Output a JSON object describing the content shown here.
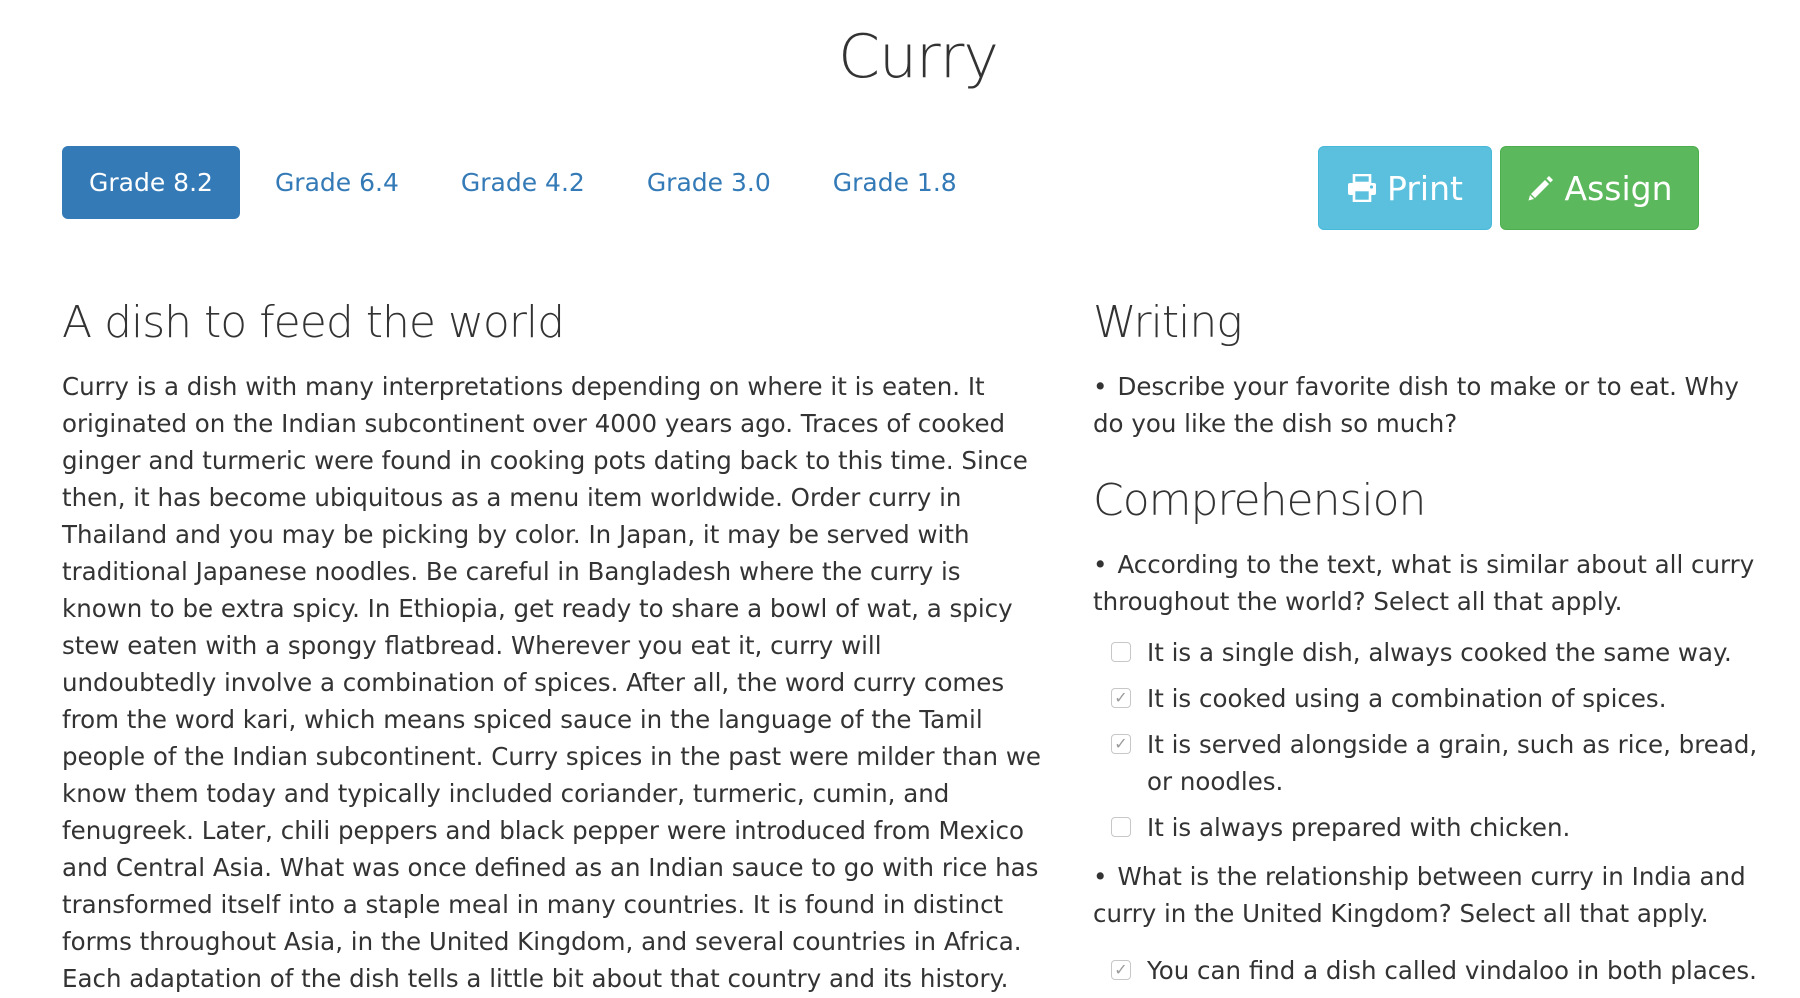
{
  "page_title": "Curry",
  "grade_tabs": [
    {
      "label": "Grade 8.2",
      "active": true
    },
    {
      "label": "Grade 6.4",
      "active": false
    },
    {
      "label": "Grade 4.2",
      "active": false
    },
    {
      "label": "Grade 3.0",
      "active": false
    },
    {
      "label": "Grade 1.8",
      "active": false
    }
  ],
  "actions": {
    "print_label": "Print",
    "print_icon": "printer-icon",
    "assign_label": "Assign",
    "assign_icon": "pencil-icon"
  },
  "colors": {
    "tab_active_bg": "#337ab7",
    "tab_link": "#337ab7",
    "print_bg": "#5bc0de",
    "assign_bg": "#5cb85c"
  },
  "article": {
    "heading": "A dish to feed the world",
    "body": "Curry is a dish with many interpretations depending on where it is eaten. It originated on the Indian subcontinent over 4000 years ago. Traces of cooked ginger and turmeric were found in cooking pots dating back to this time. Since then, it has become ubiquitous as a menu item worldwide. Order curry in Thailand and you may be picking by color. In Japan, it may be served with traditional Japanese noodles. Be careful in Bangladesh where the curry is known to be extra spicy. In Ethiopia, get ready to share a bowl of wat, a spicy stew eaten with a spongy flatbread. Wherever you eat it, curry will undoubtedly involve a combination of spices. After all, the word curry comes from the word kari, which means spiced sauce in the language of the Tamil people of the Indian subcontinent. Curry spices in the past were milder than we know them today and typically included coriander, turmeric, cumin, and fenugreek. Later, chili peppers and black pepper were introduced from Mexico and Central Asia. What was once defined as an Indian sauce to go with rice has transformed itself into a staple meal in many countries. It is found in distinct forms throughout Asia, in the United Kingdom, and several countries in Africa. Each adaptation of the dish tells a little bit about that country and its history."
  },
  "writing": {
    "heading": "Writing",
    "bullet": "•",
    "prompt": "Describe your favorite dish to make or to eat. Why do you like the dish so much?"
  },
  "comprehension": {
    "heading": "Comprehension",
    "questions": [
      {
        "bullet": "•",
        "text": "According to the text, what is similar about all curry throughout the world? Select all that apply.",
        "options": [
          {
            "text": "It is a single dish, always cooked the same way.",
            "checked": false
          },
          {
            "text": "It is cooked using a combination of spices.",
            "checked": true
          },
          {
            "text": "It is served alongside a grain, such as rice, bread, or noodles.",
            "checked": true
          },
          {
            "text": "It is always prepared with chicken.",
            "checked": false
          }
        ]
      },
      {
        "bullet": "•",
        "text": "What is the relationship between curry in India and curry in the United Kingdom? Select all that apply.",
        "options": [
          {
            "text": "You can find a dish called vindaloo in both places.",
            "checked": true
          }
        ]
      }
    ],
    "check_mark": "✓"
  }
}
